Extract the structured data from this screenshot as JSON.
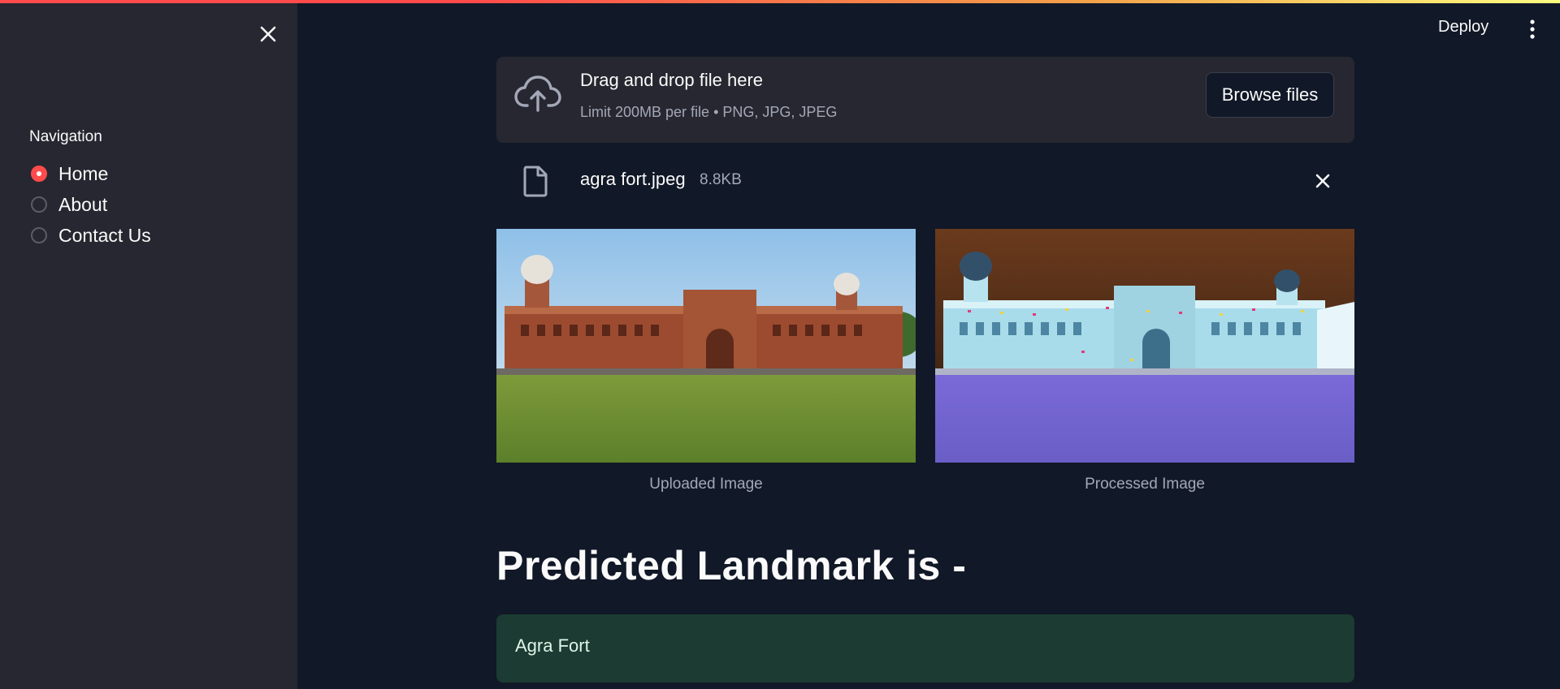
{
  "sidebar": {
    "close_icon": "close-icon",
    "nav_label": "Navigation",
    "items": [
      {
        "label": "Home",
        "selected": true
      },
      {
        "label": "About",
        "selected": false
      },
      {
        "label": "Contact Us",
        "selected": false
      }
    ]
  },
  "header": {
    "deploy_label": "Deploy",
    "menu_icon": "vertical-ellipsis-icon"
  },
  "uploader": {
    "icon": "cloud-upload-icon",
    "title": "Drag and drop file here",
    "subtitle": "Limit 200MB per file • PNG, JPG, JPEG",
    "browse_label": "Browse files"
  },
  "file": {
    "icon": "file-icon",
    "name": "agra fort.jpeg",
    "size": "8.8KB",
    "remove_icon": "close-icon"
  },
  "images": {
    "uploaded_caption": "Uploaded Image",
    "processed_caption": "Processed Image"
  },
  "result": {
    "heading": "Predicted Landmark is -",
    "value": "Agra Fort"
  },
  "colors": {
    "accent": "#ff4b4b",
    "background": "#111827",
    "sidebar": "#262730",
    "success_bg": "#1c3b32"
  }
}
